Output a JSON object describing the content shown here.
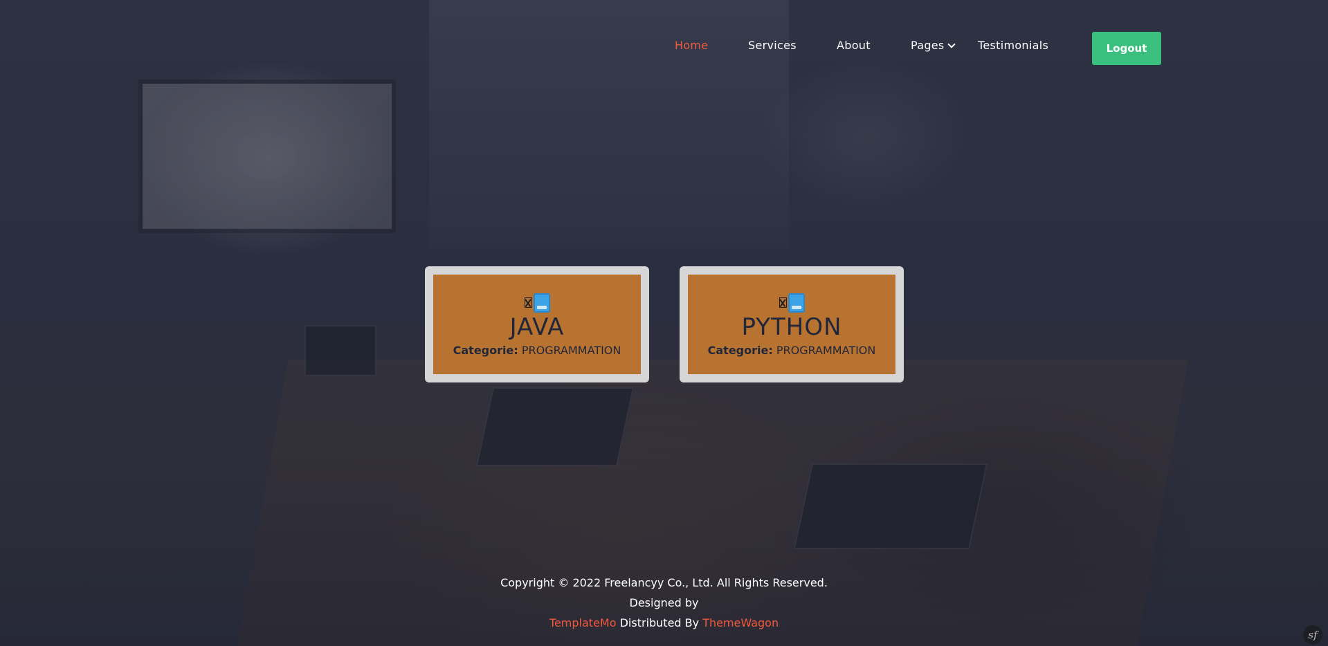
{
  "nav": {
    "items": [
      {
        "label": "Home",
        "active": true
      },
      {
        "label": "Services"
      },
      {
        "label": "About"
      },
      {
        "label": "Pages",
        "has_dropdown": true
      },
      {
        "label": "Testimonials"
      }
    ],
    "logout_label": "Logout"
  },
  "cards": [
    {
      "title": "JAVA",
      "category_label": "Categorie:",
      "category_value": "PROGRAMMATION",
      "icon": "book-icon"
    },
    {
      "title": "PYTHON",
      "category_label": "Categorie:",
      "category_value": "PROGRAMMATION",
      "icon": "book-icon"
    }
  ],
  "footer": {
    "copyright": "Copyright © 2022 Freelancyy Co., Ltd. All Rights Reserved.",
    "designed_by": "Designed by",
    "templatemo": "TemplateMo",
    "distributed_by": "Distributed By",
    "themewagon": "ThemeWagon"
  },
  "colors": {
    "accent": "#f05a3c",
    "logout": "#3bbf7f",
    "card": "#b97330",
    "card_border": "#d6d6d6"
  },
  "debug_badge": {
    "icon": "symfony-icon",
    "label": "sf"
  }
}
